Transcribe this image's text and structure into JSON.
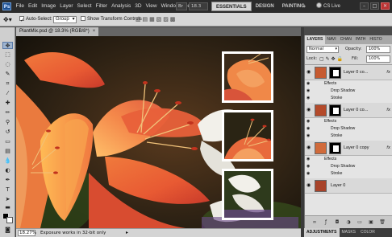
{
  "app": {
    "logo": "Ps"
  },
  "menu": [
    "File",
    "Edit",
    "Image",
    "Layer",
    "Select",
    "Filter",
    "Analysis",
    "3D",
    "View",
    "Window",
    "Help"
  ],
  "menubar_controls": {
    "zoom": "18.3"
  },
  "workspaces": {
    "active": "ESSENTIALS",
    "others": [
      "DESIGN",
      "PAINTING"
    ],
    "more": "»"
  },
  "cs_live": "CS Live",
  "window_buttons": [
    "–",
    "□",
    "✕"
  ],
  "options": {
    "auto_select_label": "Auto-Select:",
    "auto_select_checked": true,
    "auto_select_value": "Group",
    "show_transform_label": "Show Transform Controls",
    "show_transform_checked": false
  },
  "document": {
    "tab_title": "PlantMix.psd @ 18.3% (RGB/8*)",
    "close": "×"
  },
  "status": {
    "zoom": "18.27%",
    "message": "Exposure works in 32-bit only",
    "arrow": "▸"
  },
  "panel": {
    "tabs": [
      "LAYERS",
      "NAVI",
      "CHAN",
      "PATH",
      "HISTO"
    ],
    "active_tab": "LAYERS",
    "blend_mode": "Normal",
    "opacity_label": "Opacity:",
    "opacity_value": "100%",
    "lock_label": "Lock:",
    "fill_label": "Fill:",
    "fill_value": "100%",
    "layers": [
      {
        "name": "Layer 0 co...",
        "fx": "fx",
        "effects": [
          "Effects",
          "Drop Shadow",
          "Stroke"
        ]
      },
      {
        "name": "Layer 0 co...",
        "fx": "fx",
        "effects": [
          "Effects",
          "Drop Shadow",
          "Stroke"
        ]
      },
      {
        "name": "Layer 0 copy",
        "fx": "fx",
        "effects": [
          "Effects",
          "Drop Shadow",
          "Stroke"
        ]
      },
      {
        "name": "Layer 0"
      }
    ]
  },
  "bottom_tabs": [
    "ADJUSTMENTS",
    "MASKS",
    "COLOR"
  ],
  "bottom_active": "ADJUSTMENTS",
  "colors": {
    "menubar": "#2b2b2b",
    "accent": "#1d4f91",
    "workspace_active": "#d4d4d4"
  }
}
